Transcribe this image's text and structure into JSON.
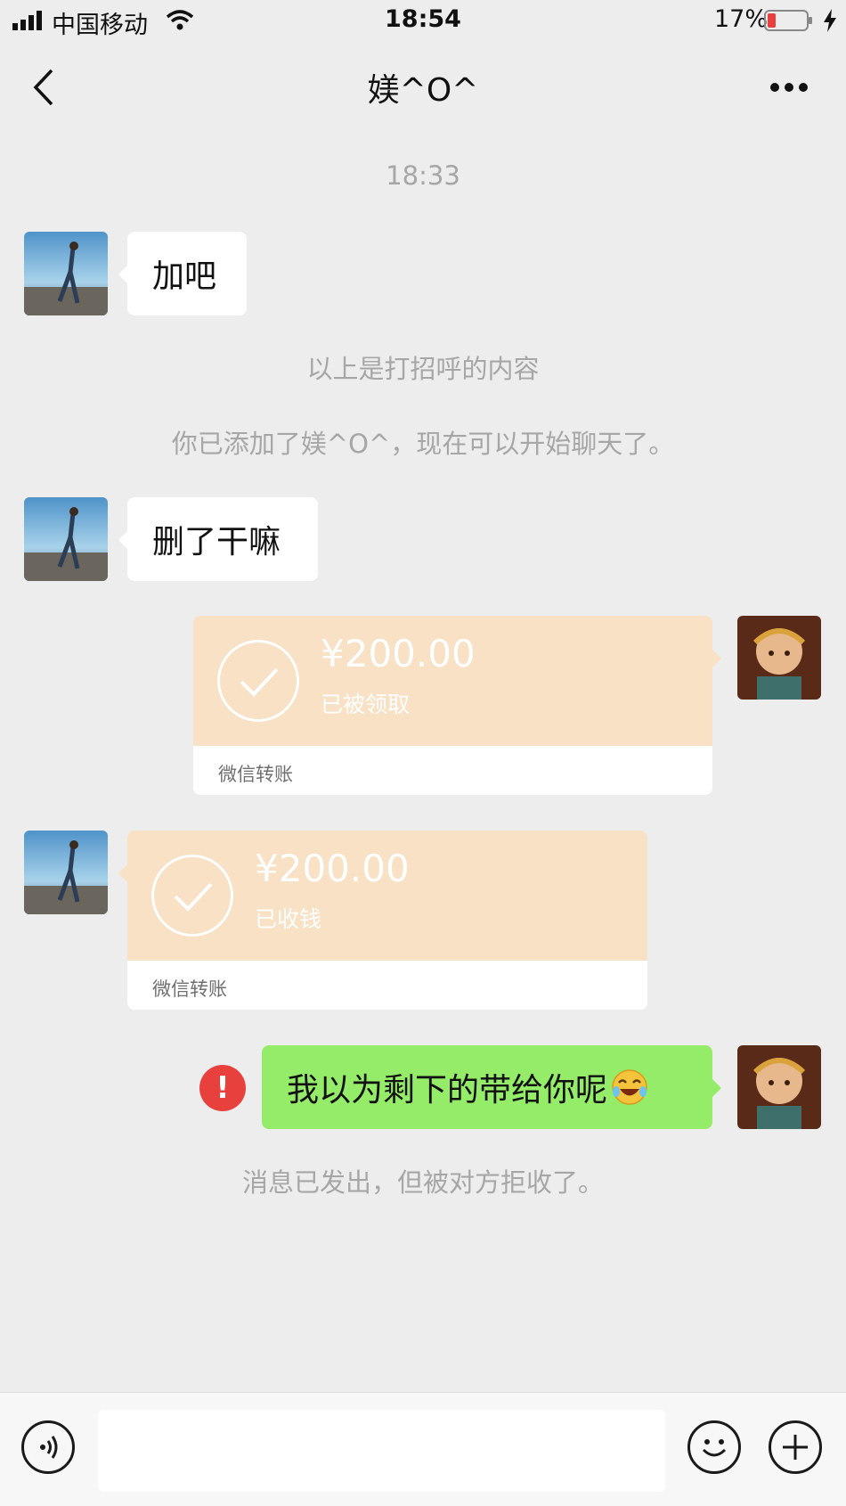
{
  "status_bar": {
    "carrier": "中国移动",
    "time": "18:54",
    "battery": "17%"
  },
  "nav": {
    "title": "媄^O^"
  },
  "chat": {
    "time_label": "18:33",
    "msg1": "加吧",
    "note_greeting": "以上是打招呼的内容",
    "note_added": "你已添加了媄^O^，现在可以开始聊天了。",
    "msg2": "删了干嘛",
    "transfer_sent": {
      "amount": "¥200.00",
      "status": "已被领取",
      "label": "微信转账"
    },
    "transfer_received": {
      "amount": "¥200.00",
      "status": "已收钱",
      "label": "微信转账"
    },
    "msg3": "我以为剩下的带给你呢",
    "error_mark": "!",
    "rejected_note": "消息已发出，但被对方拒收了。"
  },
  "colors": {
    "background": "#ededed",
    "green_bubble": "#95ec69",
    "transfer_orange": "#f8e1c4",
    "error_red": "#e8403d"
  }
}
